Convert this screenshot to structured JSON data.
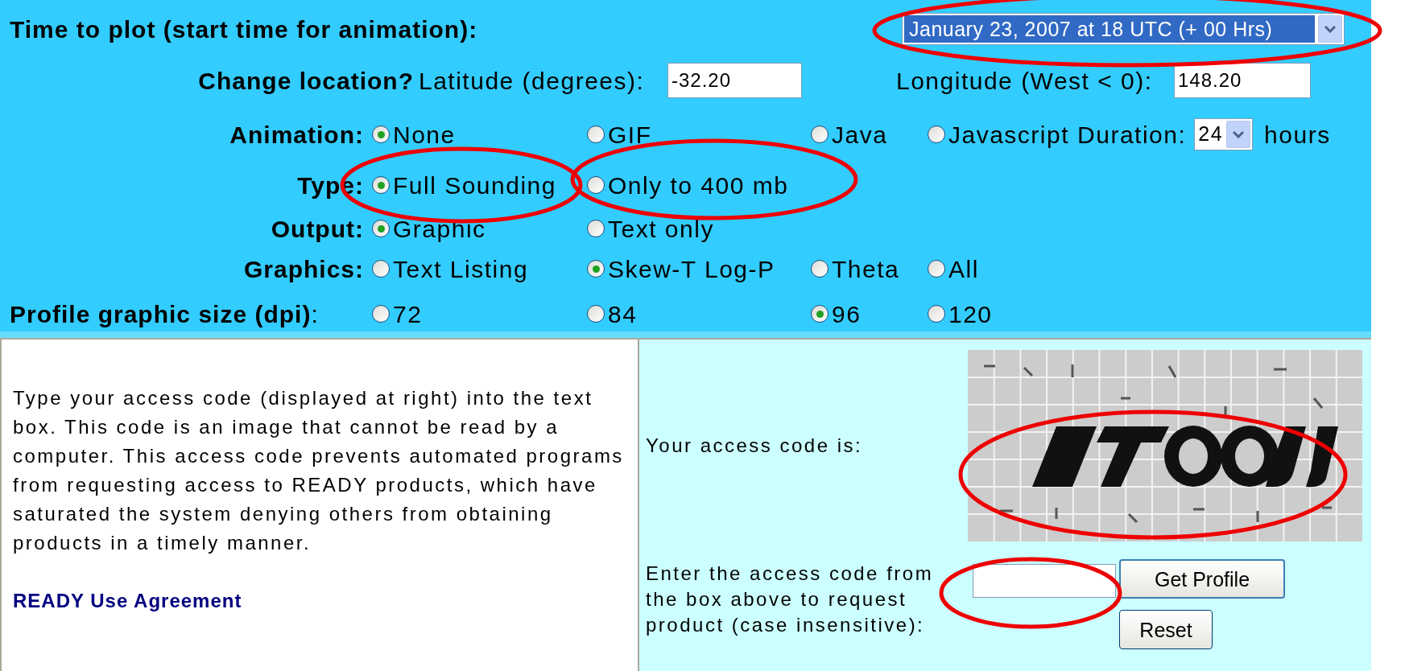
{
  "time_to_plot": {
    "label": "Time to plot (start time for animation):",
    "value": "January 23, 2007 at 18 UTC (+ 00 Hrs)"
  },
  "location": {
    "label": "Change location?",
    "latitude": {
      "label": "Latitude (degrees):",
      "value": "-32.20"
    },
    "longitude": {
      "label": "Longitude (West < 0):",
      "value": "148.20"
    }
  },
  "option_rows": [
    {
      "label": "Animation:",
      "options": [
        {
          "label": "None",
          "selected": true
        },
        {
          "label": "GIF",
          "selected": false
        },
        {
          "label": "Java",
          "selected": false
        },
        {
          "label": "Javascript",
          "selected": false
        }
      ],
      "duration": {
        "label": "Duration:",
        "value": "24",
        "unit": "hours"
      }
    },
    {
      "label": "Type:",
      "options": [
        {
          "label": "Full Sounding",
          "selected": true
        },
        {
          "label": "Only to 400 mb",
          "selected": false
        }
      ]
    },
    {
      "label": "Output:",
      "options": [
        {
          "label": "Graphic",
          "selected": true
        },
        {
          "label": "Text only",
          "selected": false
        }
      ]
    },
    {
      "label": "Graphics:",
      "options": [
        {
          "label": "Text Listing",
          "selected": false
        },
        {
          "label": "Skew-T Log-P",
          "selected": true
        },
        {
          "label": "Theta",
          "selected": false
        },
        {
          "label": "All",
          "selected": false
        }
      ]
    },
    {
      "label": "Profile graphic size (dpi)",
      "label_suffix": ":",
      "options": [
        {
          "label": "72",
          "selected": false
        },
        {
          "label": "84",
          "selected": false
        },
        {
          "label": "96",
          "selected": true
        },
        {
          "label": "120",
          "selected": false
        }
      ]
    }
  ],
  "info": {
    "text": "Type your access code (displayed at right) into the text box. This code is an image that cannot be read by a computer. This access code prevents automated programs from requesting access to READY products, which have saturated the system denying others from obtaining products in a timely manner.",
    "link": "READY Use Agreement"
  },
  "access": {
    "code_label": "Your access code is:",
    "entry_label": "Enter the access code from the box above to request product (case insensitive):",
    "submit": "Get Profile",
    "reset": "Reset"
  }
}
